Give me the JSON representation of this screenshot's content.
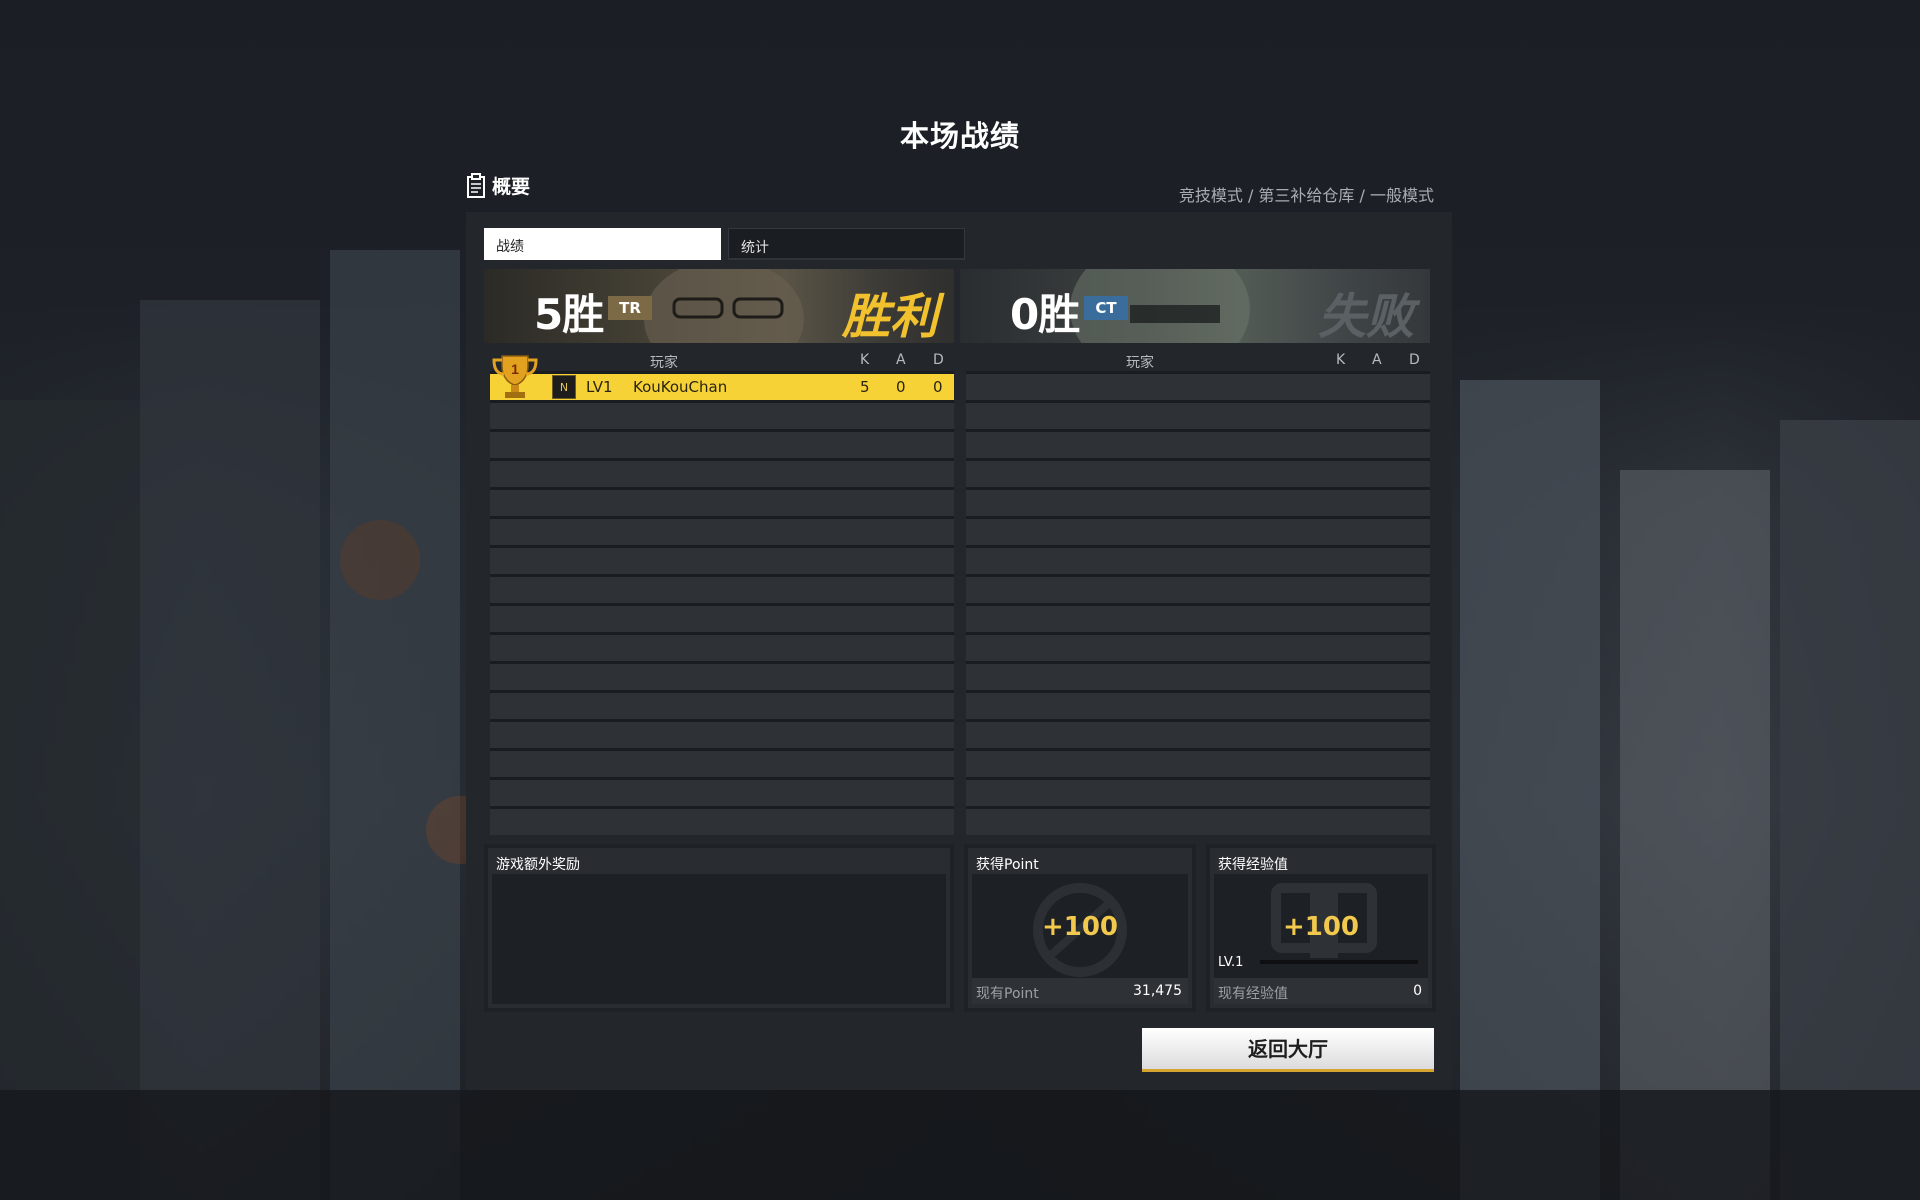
{
  "title": "本场战绩",
  "summary": {
    "label": "概要",
    "mode_path": "竞技模式 / 第三补给仓库 / 一般模式"
  },
  "tabs": [
    {
      "label": "战绩"
    },
    {
      "label": "统计"
    }
  ],
  "teams": {
    "tr": {
      "wins": "5胜",
      "badge": "TR",
      "result": "胜利"
    },
    "ct": {
      "wins": "0胜",
      "badge": "CT",
      "result": "失败"
    }
  },
  "columns": {
    "player": "玩家",
    "k": "K",
    "a": "A",
    "d": "D"
  },
  "player": {
    "trophy_rank": "1",
    "rank_icon": "N",
    "level": "LV1",
    "name": "KouKouChan",
    "k": "5",
    "a": "0",
    "d": "0"
  },
  "bonus": {
    "title": "游戏额外奖励"
  },
  "points": {
    "title": "获得Point",
    "value": "+100",
    "current_label": "现有Point",
    "current_value": "31,475"
  },
  "exp": {
    "title": "获得经验值",
    "value": "+100",
    "level": "LV.1",
    "progress": 0,
    "current_label": "现有经验值",
    "current_value": "0"
  },
  "return_button": "返回大厅",
  "colors": {
    "accent_gold": "#f7d236",
    "tr_badge": "#7c6a47",
    "ct_badge": "#3a6d9c",
    "victory": "#f2c12e",
    "defeat": "#5b6065"
  }
}
